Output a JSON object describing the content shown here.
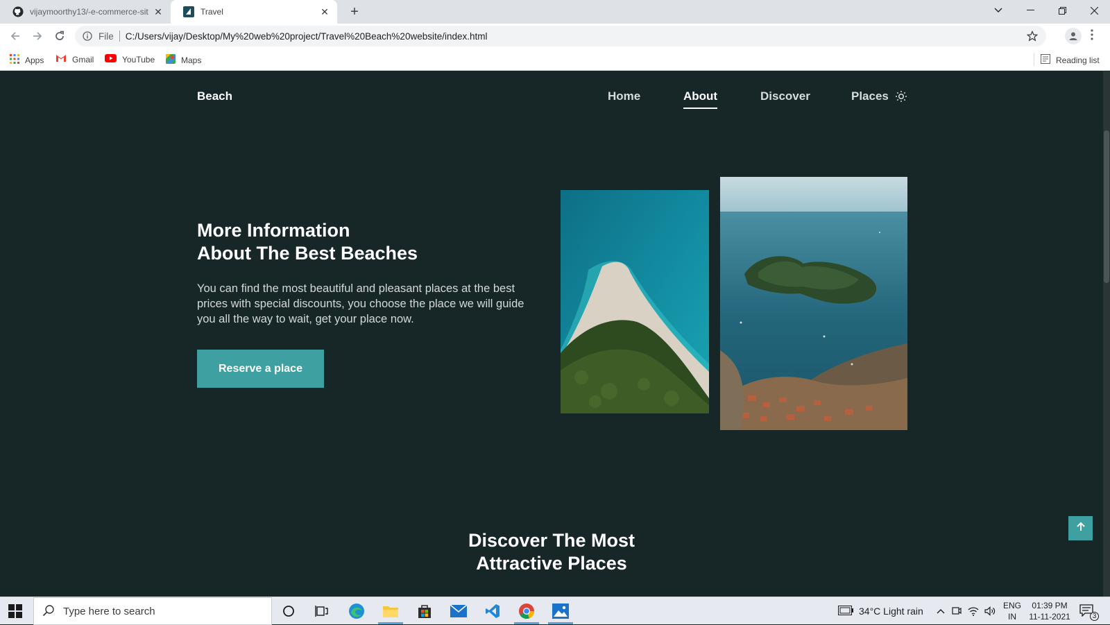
{
  "browser": {
    "tabs": [
      {
        "title": "vijaymoorthy13/-e-commerce-sit",
        "icon": "github-icon",
        "active": false
      },
      {
        "title": "Travel",
        "icon": "travel-favicon",
        "active": true
      }
    ],
    "scheme_label": "File",
    "url": "C:/Users/vijay/Desktop/My%20web%20project/Travel%20Beach%20website/index.html",
    "bookmarks": [
      {
        "label": "Apps",
        "icon": "apps-grid-icon"
      },
      {
        "label": "Gmail",
        "icon": "gmail-icon"
      },
      {
        "label": "YouTube",
        "icon": "youtube-icon"
      },
      {
        "label": "Maps",
        "icon": "maps-icon"
      }
    ],
    "reading_list": "Reading list"
  },
  "site": {
    "logo": "Beach",
    "nav": [
      {
        "label": "Home",
        "active": false
      },
      {
        "label": "About",
        "active": true
      },
      {
        "label": "Discover",
        "active": false
      },
      {
        "label": "Places",
        "active": false
      }
    ],
    "about": {
      "title_line1": "More Information",
      "title_line2": "About The Best Beaches",
      "description": "You can find the most beautiful and pleasant places at the best prices with special discounts, you choose the place we will guide you all the way to wait, get your place now.",
      "button": "Reserve a place"
    },
    "discover": {
      "title_line1": "Discover The Most",
      "title_line2": "Attractive Places"
    },
    "accent_color": "#3ea0a0",
    "background_color": "#172627"
  },
  "taskbar": {
    "search_placeholder": "Type here to search",
    "weather": "34°C  Light rain",
    "lang_line1": "ENG",
    "lang_line2": "IN",
    "time": "01:39 PM",
    "date": "11-11-2021",
    "notification_count": "3"
  }
}
